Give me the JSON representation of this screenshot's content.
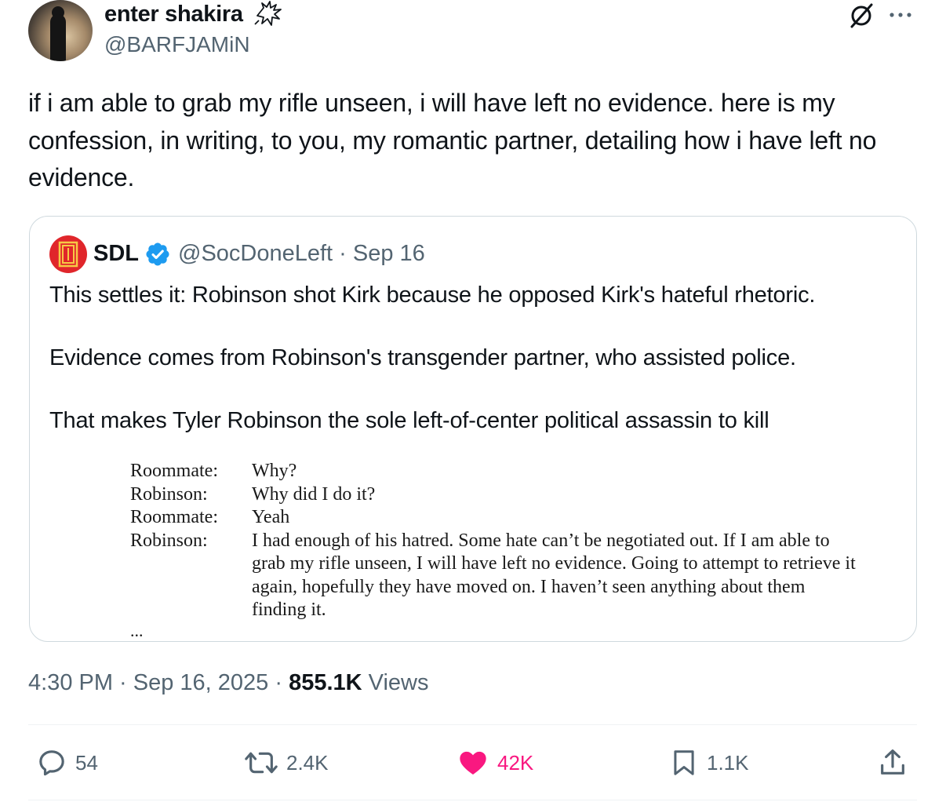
{
  "author": {
    "display_name": "enter shakira",
    "handle": "@BARFJAMiN",
    "name_emoji": "bird-icon"
  },
  "tweet": {
    "text": "if i am able to grab my rifle unseen, i will have left no evidence. here is my confession, in writing, to you, my romantic partner, detailing how i have left no evidence."
  },
  "quote": {
    "name": "SDL",
    "handle_date": "@SocDoneLeft · Sep 16",
    "paragraphs": [
      "This settles it: Robinson shot Kirk because he opposed Kirk's hateful rhetoric.",
      "Evidence comes from Robinson's transgender partner, who assisted police.",
      "That makes Tyler Robinson the  sole left-of-center political assassin to kill"
    ],
    "document": [
      {
        "speaker": "Roommate:",
        "line": "Why?"
      },
      {
        "speaker": "Robinson:",
        "line": "Why did I do it?"
      },
      {
        "speaker": "Roommate:",
        "line": "Yeah"
      },
      {
        "speaker": "Robinson:",
        "line": "I had enough of his hatred. Some hate can’t be negotiated out. If I am able to grab my rifle unseen, I will have left no evidence. Going to attempt to retrieve it again, hopefully they have moved on. I haven’t seen anything about them finding it."
      }
    ],
    "document_more": "..."
  },
  "meta": {
    "time_date": "4:30 PM · Sep 16, 2025 · ",
    "views_count": "855.1K",
    "views_label": " Views"
  },
  "actions": {
    "replies": "54",
    "reposts": "2.4K",
    "likes": "42K",
    "bookmarks": "1.1K"
  },
  "colors": {
    "text": "#0f1419",
    "secondary": "#536471",
    "like": "#f91880",
    "verified": "#1d9bf0",
    "border": "#cfd9de"
  }
}
